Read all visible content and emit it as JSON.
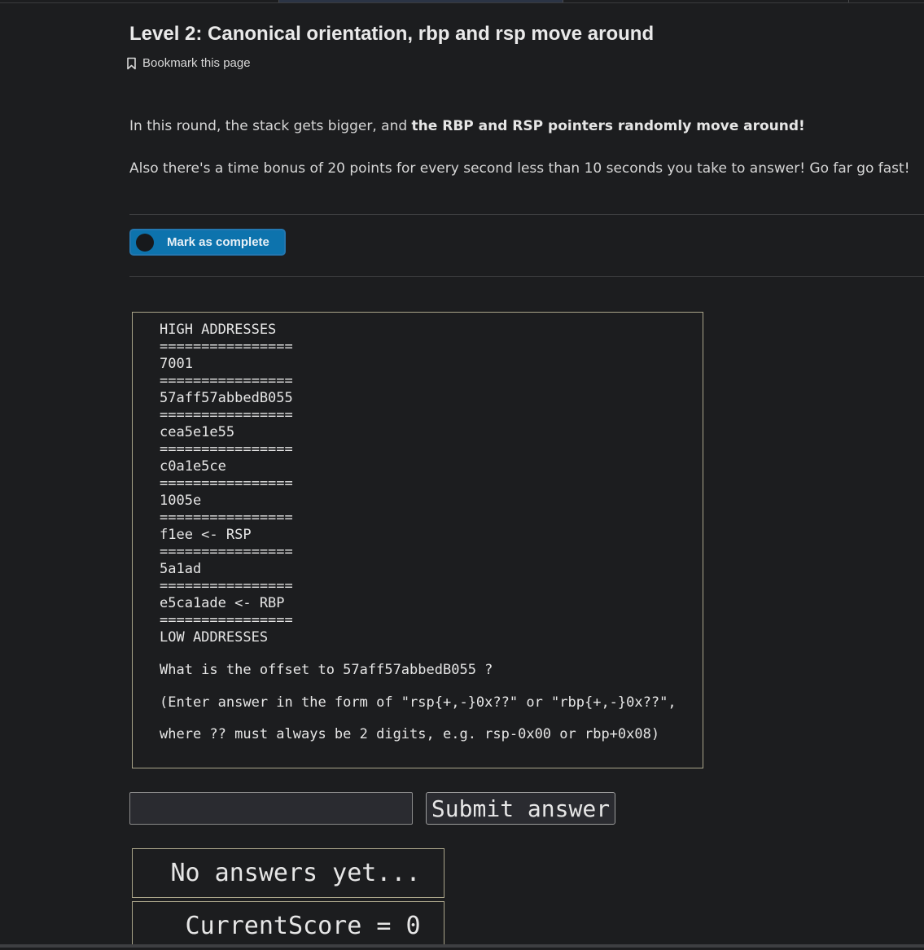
{
  "header": {
    "title": "Level 2: Canonical orientation, rbp and rsp move around",
    "bookmark_label": "Bookmark this page"
  },
  "intro": {
    "p1_prefix": "In this round, the stack gets bigger, and ",
    "p1_bold": "the RBP and RSP pointers randomly move around!",
    "p2": "Also there's a time bonus of 20 points for every second less than 10 seconds you take to answer! Go far go fast!"
  },
  "complete_button": {
    "label": "Mark as complete",
    "checked": false
  },
  "stack": {
    "lines": [
      "HIGH ADDRESSES",
      "================",
      "7001",
      "================",
      "57aff57abbedB055",
      "================",
      "cea5e1e55",
      "================",
      "c0a1e5ce",
      "================",
      "1005e",
      "================",
      "f1ee <- RSP",
      "================",
      "5a1ad",
      "================",
      "e5ca1ade <- RBP",
      "================",
      "LOW ADDRESSES"
    ],
    "question": "What is the offset to 57aff57abbedB055 ?",
    "instructions_1": "(Enter answer in the form of \"rsp{+,-}0x??\" or \"rbp{+,-}0x??\",",
    "instructions_2": "where ?? must always be 2 digits, e.g. rsp-0x00 or rbp+0x08)"
  },
  "answer_form": {
    "input_value": "",
    "input_placeholder": "",
    "submit_label": "Submit answer"
  },
  "results": {
    "status_text": " No answers yet...",
    "score_text": "  CurrentScore = 0"
  },
  "colors": {
    "background": "#1c1d1f",
    "accent_button": "#0d73ad",
    "box_border": "#aaa58a"
  }
}
